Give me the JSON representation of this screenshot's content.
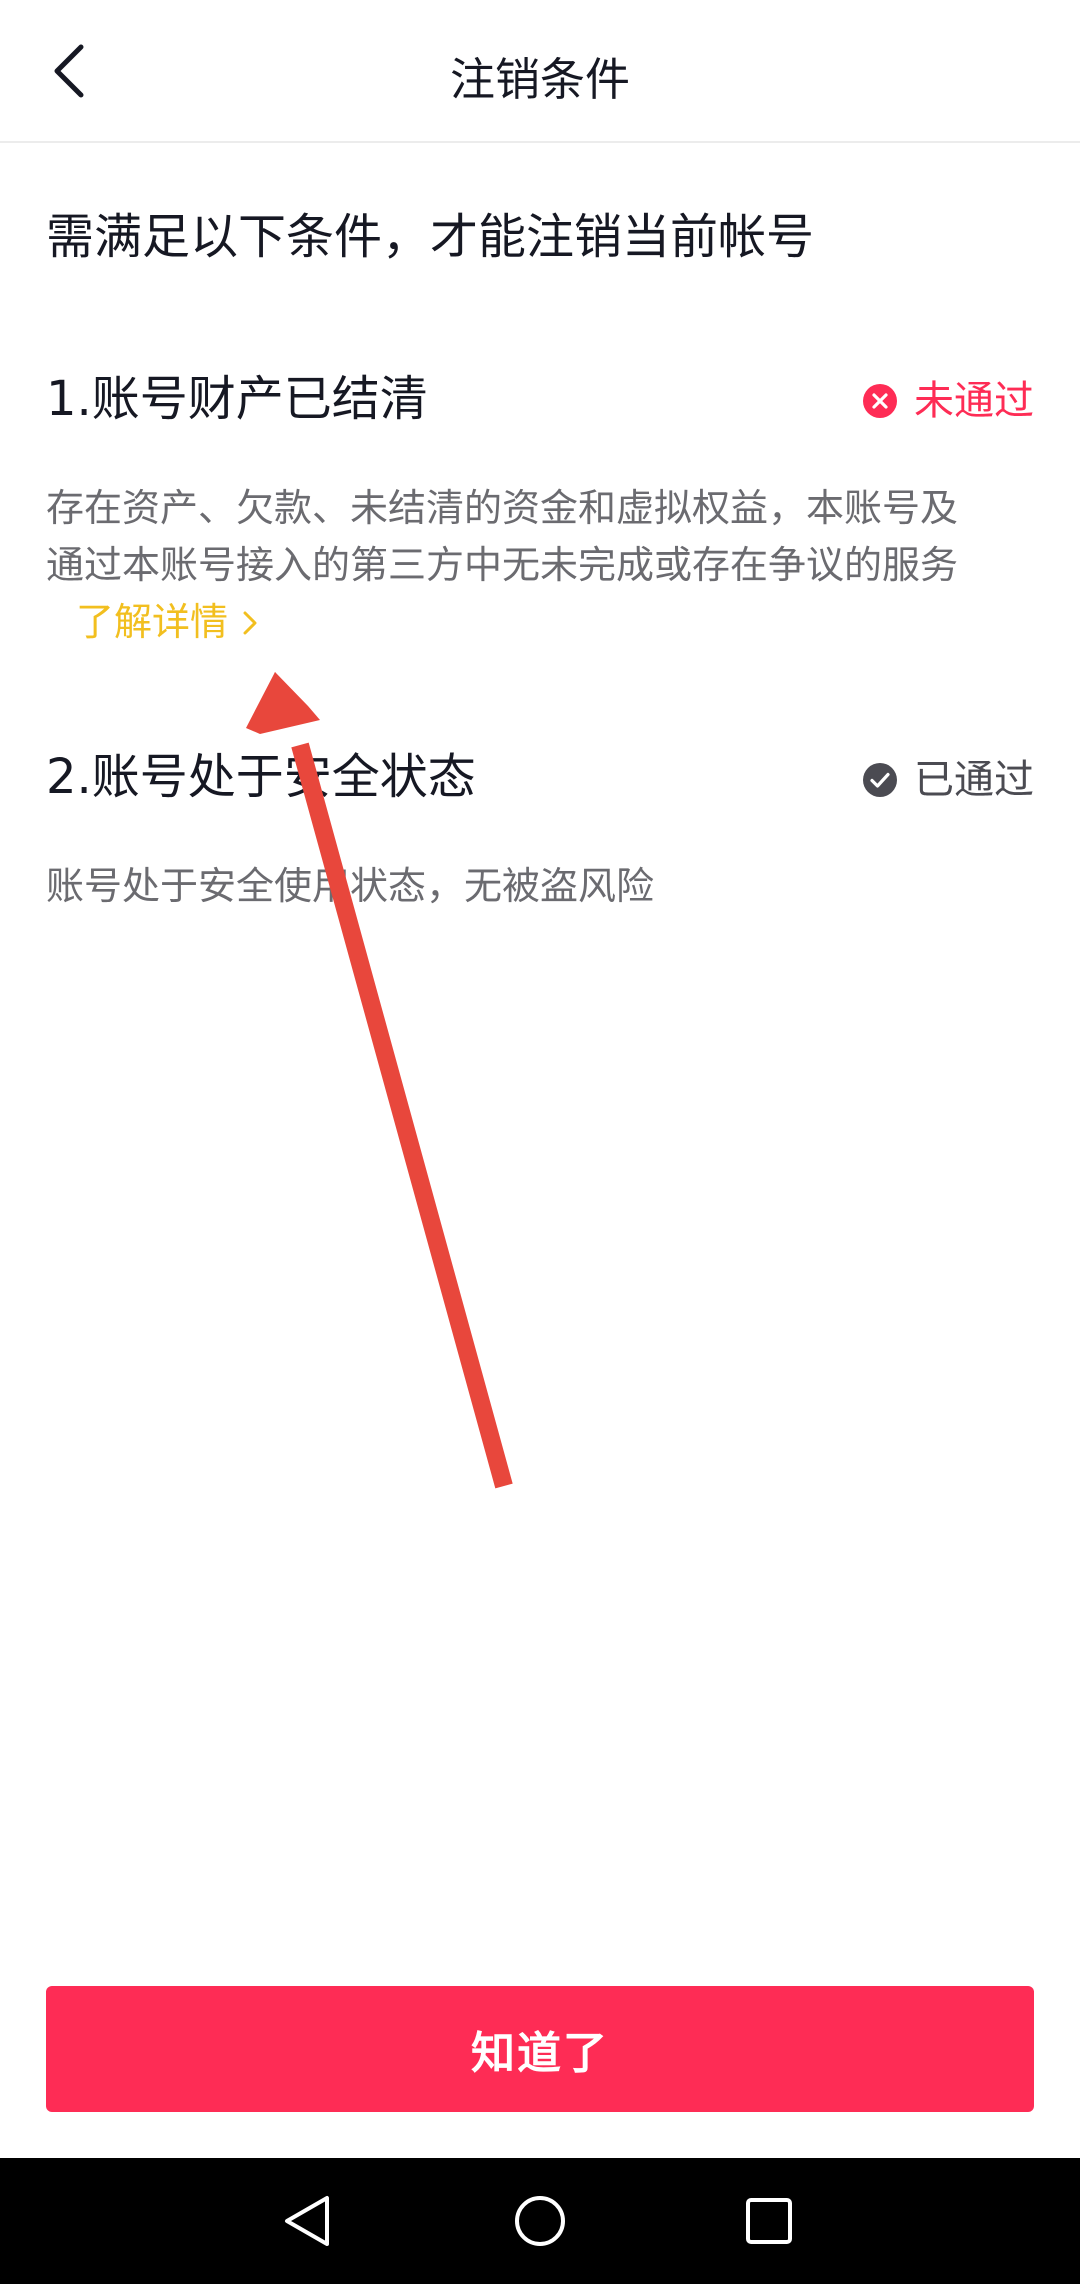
{
  "header": {
    "title": "注销条件"
  },
  "intro": "需满足以下条件，才能注销当前帐号",
  "conditions": [
    {
      "title": "1.账号财产已结清",
      "status": "未通过",
      "description_line1": "存在资产、欠款、未结清的资金和虚拟权益，本账号及",
      "description_line2": "通过本账号接入的第三方中无未完成或存在争议的服务",
      "link_label": "了解详情"
    },
    {
      "title": "2.账号处于安全状态",
      "status": "已通过",
      "description": "账号处于安全使用状态，无被盗风险"
    }
  ],
  "primary_button": {
    "label": "知道了"
  },
  "colors": {
    "accent": "#fe2c55",
    "link": "#f2bf1f",
    "pass": "#4b4b52",
    "annotation_arrow": "#e8473c",
    "nav_bar": "#000000"
  },
  "icons": {
    "back": "chevron-left-icon",
    "fail": "close-circle-icon",
    "pass": "check-circle-icon",
    "link": "chevron-right-icon",
    "nav_back": "triangle-back-icon",
    "nav_home": "circle-home-icon",
    "nav_recent": "square-recent-icon"
  }
}
